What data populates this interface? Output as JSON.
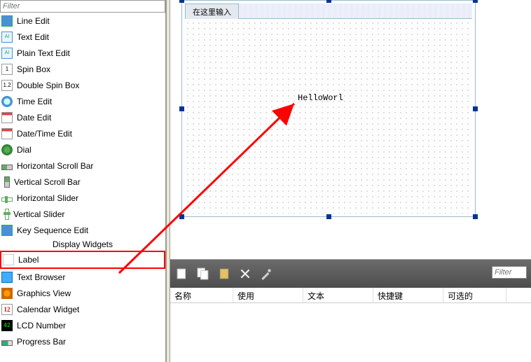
{
  "sidebar": {
    "filter_placeholder": "Filter",
    "items": [
      {
        "label": "Line Edit",
        "icon": "lineedit-icon"
      },
      {
        "label": "Text Edit",
        "icon": "textedit-icon"
      },
      {
        "label": "Plain Text Edit",
        "icon": "plaintextedit-icon"
      },
      {
        "label": "Spin Box",
        "icon": "spinbox-icon"
      },
      {
        "label": "Double Spin Box",
        "icon": "doublespinbox-icon"
      },
      {
        "label": "Time Edit",
        "icon": "timeedit-icon"
      },
      {
        "label": "Date Edit",
        "icon": "dateedit-icon"
      },
      {
        "label": "Date/Time Edit",
        "icon": "datetimeedit-icon"
      },
      {
        "label": "Dial",
        "icon": "dial-icon"
      },
      {
        "label": "Horizontal Scroll Bar",
        "icon": "hscroll-icon"
      },
      {
        "label": "Vertical Scroll Bar",
        "icon": "vscroll-icon"
      },
      {
        "label": "Horizontal Slider",
        "icon": "hslider-icon"
      },
      {
        "label": "Vertical Slider",
        "icon": "vslider-icon"
      },
      {
        "label": "Key Sequence Edit",
        "icon": "keysequence-icon"
      }
    ],
    "category": "Display Widgets",
    "display_items": [
      {
        "label": "Label",
        "icon": "label-icon"
      },
      {
        "label": "Text Browser",
        "icon": "textbrowser-icon"
      },
      {
        "label": "Graphics View",
        "icon": "graphicsview-icon"
      },
      {
        "label": "Calendar Widget",
        "icon": "calendar-icon"
      },
      {
        "label": "LCD Number",
        "icon": "lcdnumber-icon"
      },
      {
        "label": "Progress Bar",
        "icon": "progressbar-icon"
      }
    ]
  },
  "canvas": {
    "tab_label": "在这里输入",
    "label_text": "HelloWorl"
  },
  "bottom": {
    "filter_placeholder": "Filter",
    "columns": [
      "名称",
      "使用",
      "文本",
      "快捷键",
      "可选的"
    ]
  }
}
